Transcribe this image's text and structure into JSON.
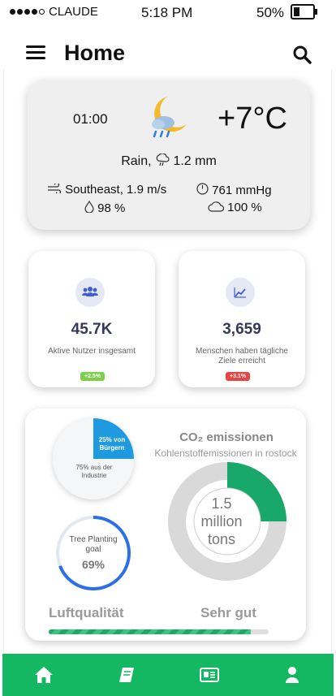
{
  "status_bar": {
    "carrier": "CLAUDE",
    "time": "5:18 PM",
    "battery": "50%"
  },
  "header": {
    "title": "Home"
  },
  "weather": {
    "time": "01:00",
    "temperature": "+7°C",
    "condition": "Rain,",
    "precipitation": "1.2 mm",
    "wind": "Southeast, 1.9 m/s",
    "pressure": "761 mmHg",
    "humidity": "98 %",
    "cloudiness": "100 %",
    "icons": [
      "moon-rain-icon",
      "rain-icon",
      "wind-icon",
      "pressure-icon",
      "humidity-icon",
      "cloud-icon"
    ]
  },
  "stats": [
    {
      "value": "45.7K",
      "label": "Aktive Nutzer insgesamt",
      "badge": "+2.5%",
      "badge_color": "#7ccf4a",
      "icon": "users-icon"
    },
    {
      "value": "3,659",
      "label": "Menschen haben tägliche Ziele erreicht",
      "badge": "+3.1%",
      "badge_color": "#e64545",
      "icon": "chart-icon"
    }
  ],
  "citizens_pie": {
    "slice_label": "25% von Bürgern",
    "rest_label": "75% aus der Industrie",
    "slice_percent": 25,
    "slice_color": "#1e9be0"
  },
  "co2": {
    "title": "CO₂ emissionen",
    "subtitle": "Kohlenstoffemissionen in rostock",
    "value": "1.5 million tons",
    "highlight_percent": 25,
    "highlight_color": "#17a86a"
  },
  "tree_goal": {
    "label": "Tree Planting goal",
    "value": "69%",
    "percent": 69,
    "color": "#2c6fe6"
  },
  "air_quality": {
    "label": "Luftqualität",
    "value": "Sehr gut",
    "level_percent": 92
  },
  "nav": {
    "items": [
      "home-icon",
      "book-icon",
      "news-icon",
      "profile-icon"
    ],
    "color": "#15b862"
  }
}
